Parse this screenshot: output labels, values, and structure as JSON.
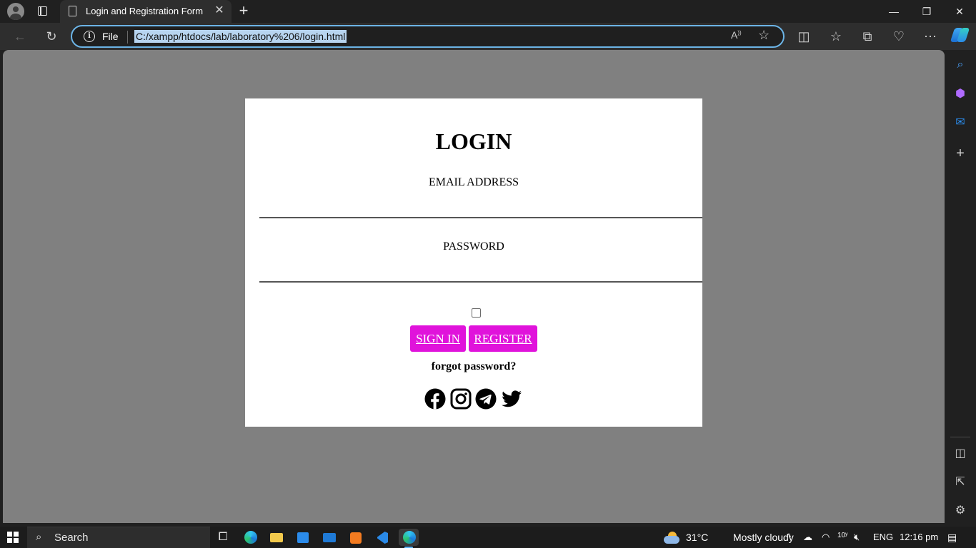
{
  "browser": {
    "tab_title": "Login and Registration Form",
    "address_scheme": "File",
    "address_url": "C:/xampp/htdocs/lab/laboratory%206/login.html"
  },
  "page": {
    "heading": "LOGIN",
    "email_label": "EMAIL ADDRESS",
    "email_value": "",
    "password_label": "PASSWORD",
    "password_value": "",
    "remember_checked": false,
    "sign_in_label": "SIGN IN",
    "register_label": "REGISTER",
    "forgot_label": "forgot password?",
    "social_icons": [
      "facebook-icon",
      "instagram-icon",
      "telegram-icon",
      "twitter-icon"
    ]
  },
  "colors": {
    "page_background": "#808080",
    "card_background": "#ffffff",
    "button_background": "#e013db",
    "button_text": "#ffffff"
  },
  "taskbar": {
    "search_label": "Search",
    "weather_temp": "31°C",
    "weather_text": "Mostly cloudy",
    "language": "ENG",
    "time": "12:16 pm"
  }
}
